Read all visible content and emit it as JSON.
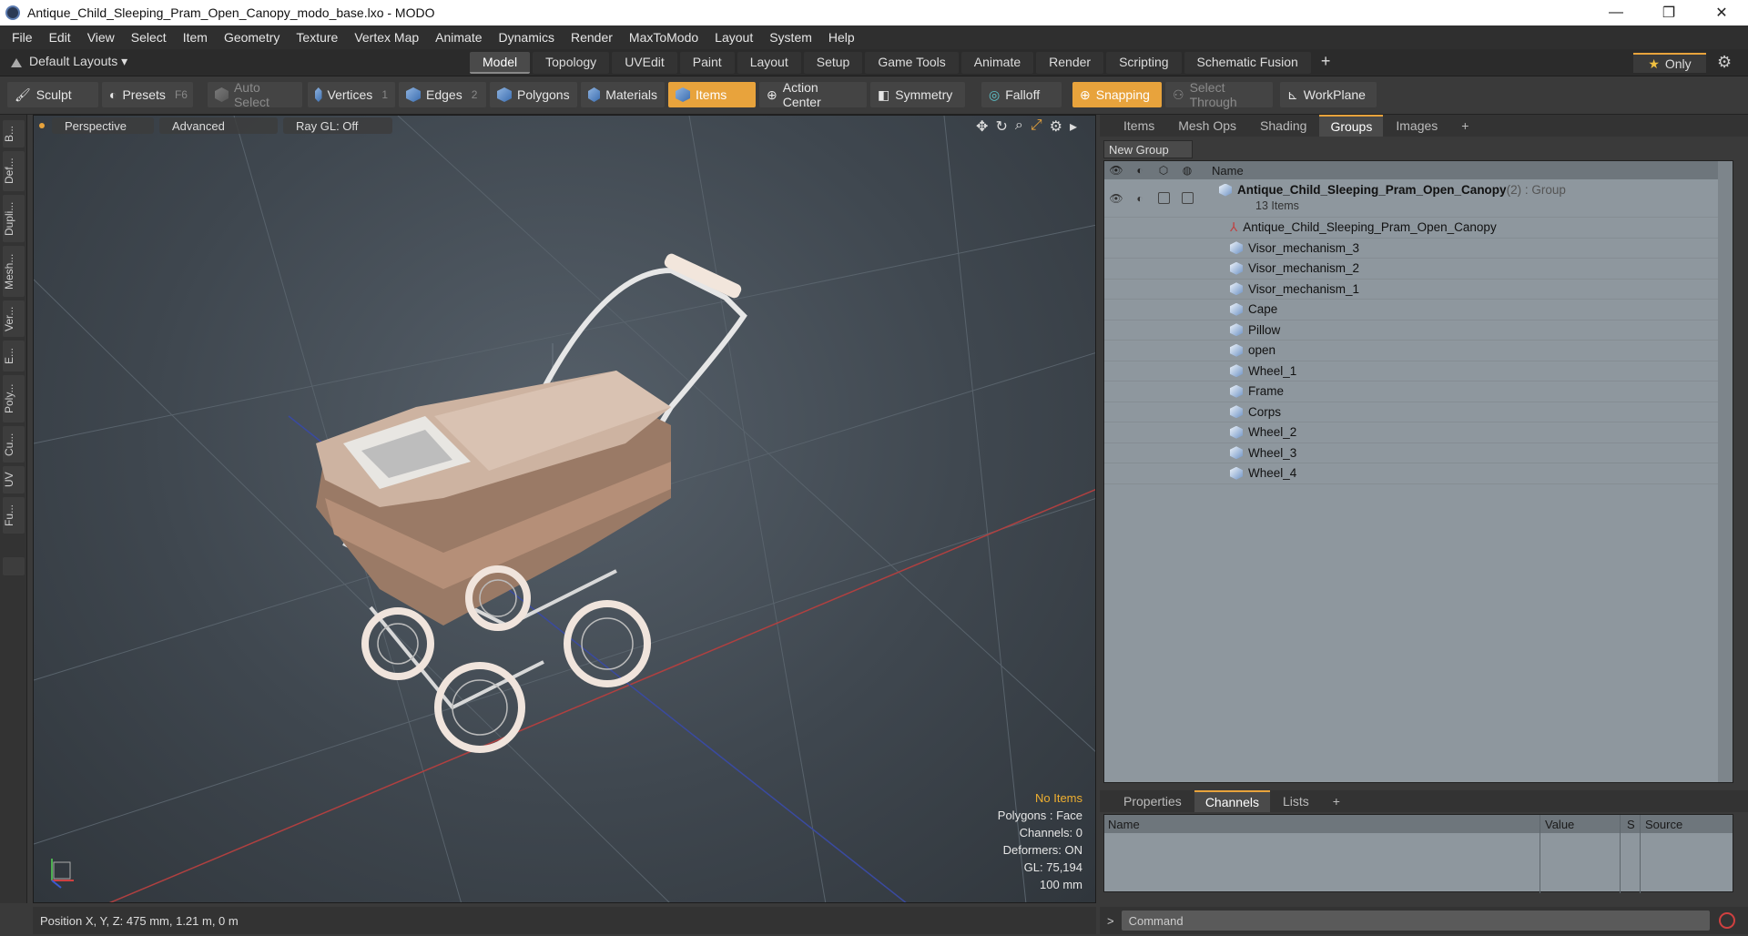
{
  "window": {
    "title": "Antique_Child_Sleeping_Pram_Open_Canopy_modo_base.lxo - MODO",
    "minimize": "—",
    "maximize": "❐",
    "close": "✕"
  },
  "menu": [
    "File",
    "Edit",
    "View",
    "Select",
    "Item",
    "Geometry",
    "Texture",
    "Vertex Map",
    "Animate",
    "Dynamics",
    "Render",
    "MaxToModo",
    "Layout",
    "System",
    "Help"
  ],
  "layouts": {
    "default_layouts": "Default Layouts ▾",
    "tabs": [
      "Model",
      "Topology",
      "UVEdit",
      "Paint",
      "Layout",
      "Setup",
      "Game Tools",
      "Animate",
      "Render",
      "Scripting",
      "Schematic Fusion"
    ],
    "active_tab": "Model",
    "plus": "+",
    "only": "Only"
  },
  "toolbar": {
    "sculpt": "Sculpt",
    "presets": "Presets",
    "presets_key": "F6",
    "auto_select": "Auto Select",
    "vertices": "Vertices",
    "vertices_num": "1",
    "edges": "Edges",
    "edges_num": "2",
    "polygons": "Polygons",
    "materials": "Materials",
    "items": "Items",
    "action_center": "Action Center",
    "symmetry": "Symmetry",
    "falloff": "Falloff",
    "snapping": "Snapping",
    "select_through": "Select Through",
    "workplane": "WorkPlane"
  },
  "left_strip": [
    "B...",
    "Def...",
    "Dupli...",
    "Mesh...",
    "Ver...",
    "E...",
    "Poly...",
    "Cu...",
    "UV",
    "Fu..."
  ],
  "viewport": {
    "perspective": "Perspective",
    "advanced": "Advanced",
    "raygl": "Ray GL: Off",
    "info": {
      "no_items": "No Items",
      "polygons": "Polygons : Face",
      "channels": "Channels: 0",
      "deformers": "Deformers: ON",
      "gl": "GL: 75,194",
      "scale": "100 mm"
    }
  },
  "position_bar": "Position X, Y, Z:   475 mm, 1.21 m, 0 m",
  "right_panel": {
    "tabs": [
      "Items",
      "Mesh Ops",
      "Shading",
      "Groups",
      "Images"
    ],
    "active_tab": "Groups",
    "plus": "+",
    "new_group": "New Group",
    "name_header": "Name",
    "group": {
      "name": "Antique_Child_Sleeping_Pram_Open_Canopy",
      "suffix": " (2) : Group",
      "count": "13 Items"
    },
    "items": [
      "Antique_Child_Sleeping_Pram_Open_Canopy",
      "Visor_mechanism_3",
      "Visor_mechanism_2",
      "Visor_mechanism_1",
      "Cape",
      "Pillow",
      "open",
      "Wheel_1",
      "Frame",
      "Corps",
      "Wheel_2",
      "Wheel_3",
      "Wheel_4"
    ]
  },
  "channels_panel": {
    "tabs": [
      "Properties",
      "Channels",
      "Lists"
    ],
    "active_tab": "Channels",
    "plus": "+",
    "columns": [
      "Name",
      "Value",
      "S",
      "Source"
    ]
  },
  "command": {
    "placeholder": "Command"
  },
  "colors": {
    "accent": "#e8a33c",
    "panel": "#3a3a3a",
    "tree_bg": "#8e979e"
  }
}
